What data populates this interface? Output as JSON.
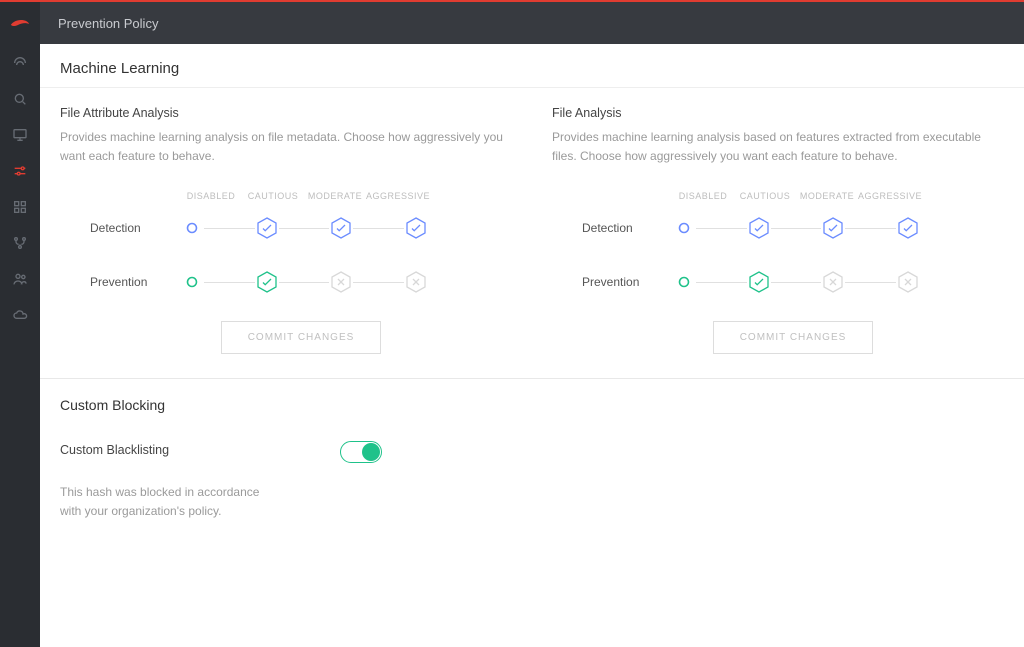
{
  "header": {
    "title": "Prevention Policy"
  },
  "sections": {
    "ml": {
      "title": "Machine Learning",
      "levels": [
        "DISABLED",
        "CAUTIOUS",
        "MODERATE",
        "AGGRESSIVE"
      ],
      "commit_label": "COMMIT CHANGES",
      "file_attribute": {
        "name": "File Attribute Analysis",
        "desc": "Provides machine learning analysis on file metadata. Choose how aggressively you want each feature to behave.",
        "rows": {
          "detection": {
            "label": "Detection",
            "color": "#6b8cff",
            "selected": 0,
            "states": [
              "dot",
              "check",
              "check",
              "check"
            ]
          },
          "prevention": {
            "label": "Prevention",
            "color": "#1fc28a",
            "selected": 0,
            "states": [
              "dot",
              "check",
              "x",
              "x"
            ]
          }
        }
      },
      "file_analysis": {
        "name": "File Analysis",
        "desc": "Provides machine learning analysis based on features extracted from executable files. Choose how aggressively you want each feature to behave.",
        "rows": {
          "detection": {
            "label": "Detection",
            "color": "#6b8cff",
            "selected": 0,
            "states": [
              "dot",
              "check",
              "check",
              "check"
            ]
          },
          "prevention": {
            "label": "Prevention",
            "color": "#1fc28a",
            "selected": 0,
            "states": [
              "dot",
              "check",
              "x",
              "x"
            ]
          }
        }
      }
    },
    "cb": {
      "title": "Custom Blocking",
      "item": {
        "name": "Custom Blacklisting",
        "desc": "This hash was blocked in accordance with your organization's policy.",
        "enabled": true
      }
    }
  },
  "sidebar_icons": [
    "wifi",
    "search",
    "monitor",
    "sliders",
    "grid",
    "branch",
    "users",
    "cloud"
  ],
  "colors": {
    "accent_red": "#e03c31",
    "blue": "#6b8cff",
    "green": "#1fc28a",
    "gray": "#c7c7c7"
  }
}
